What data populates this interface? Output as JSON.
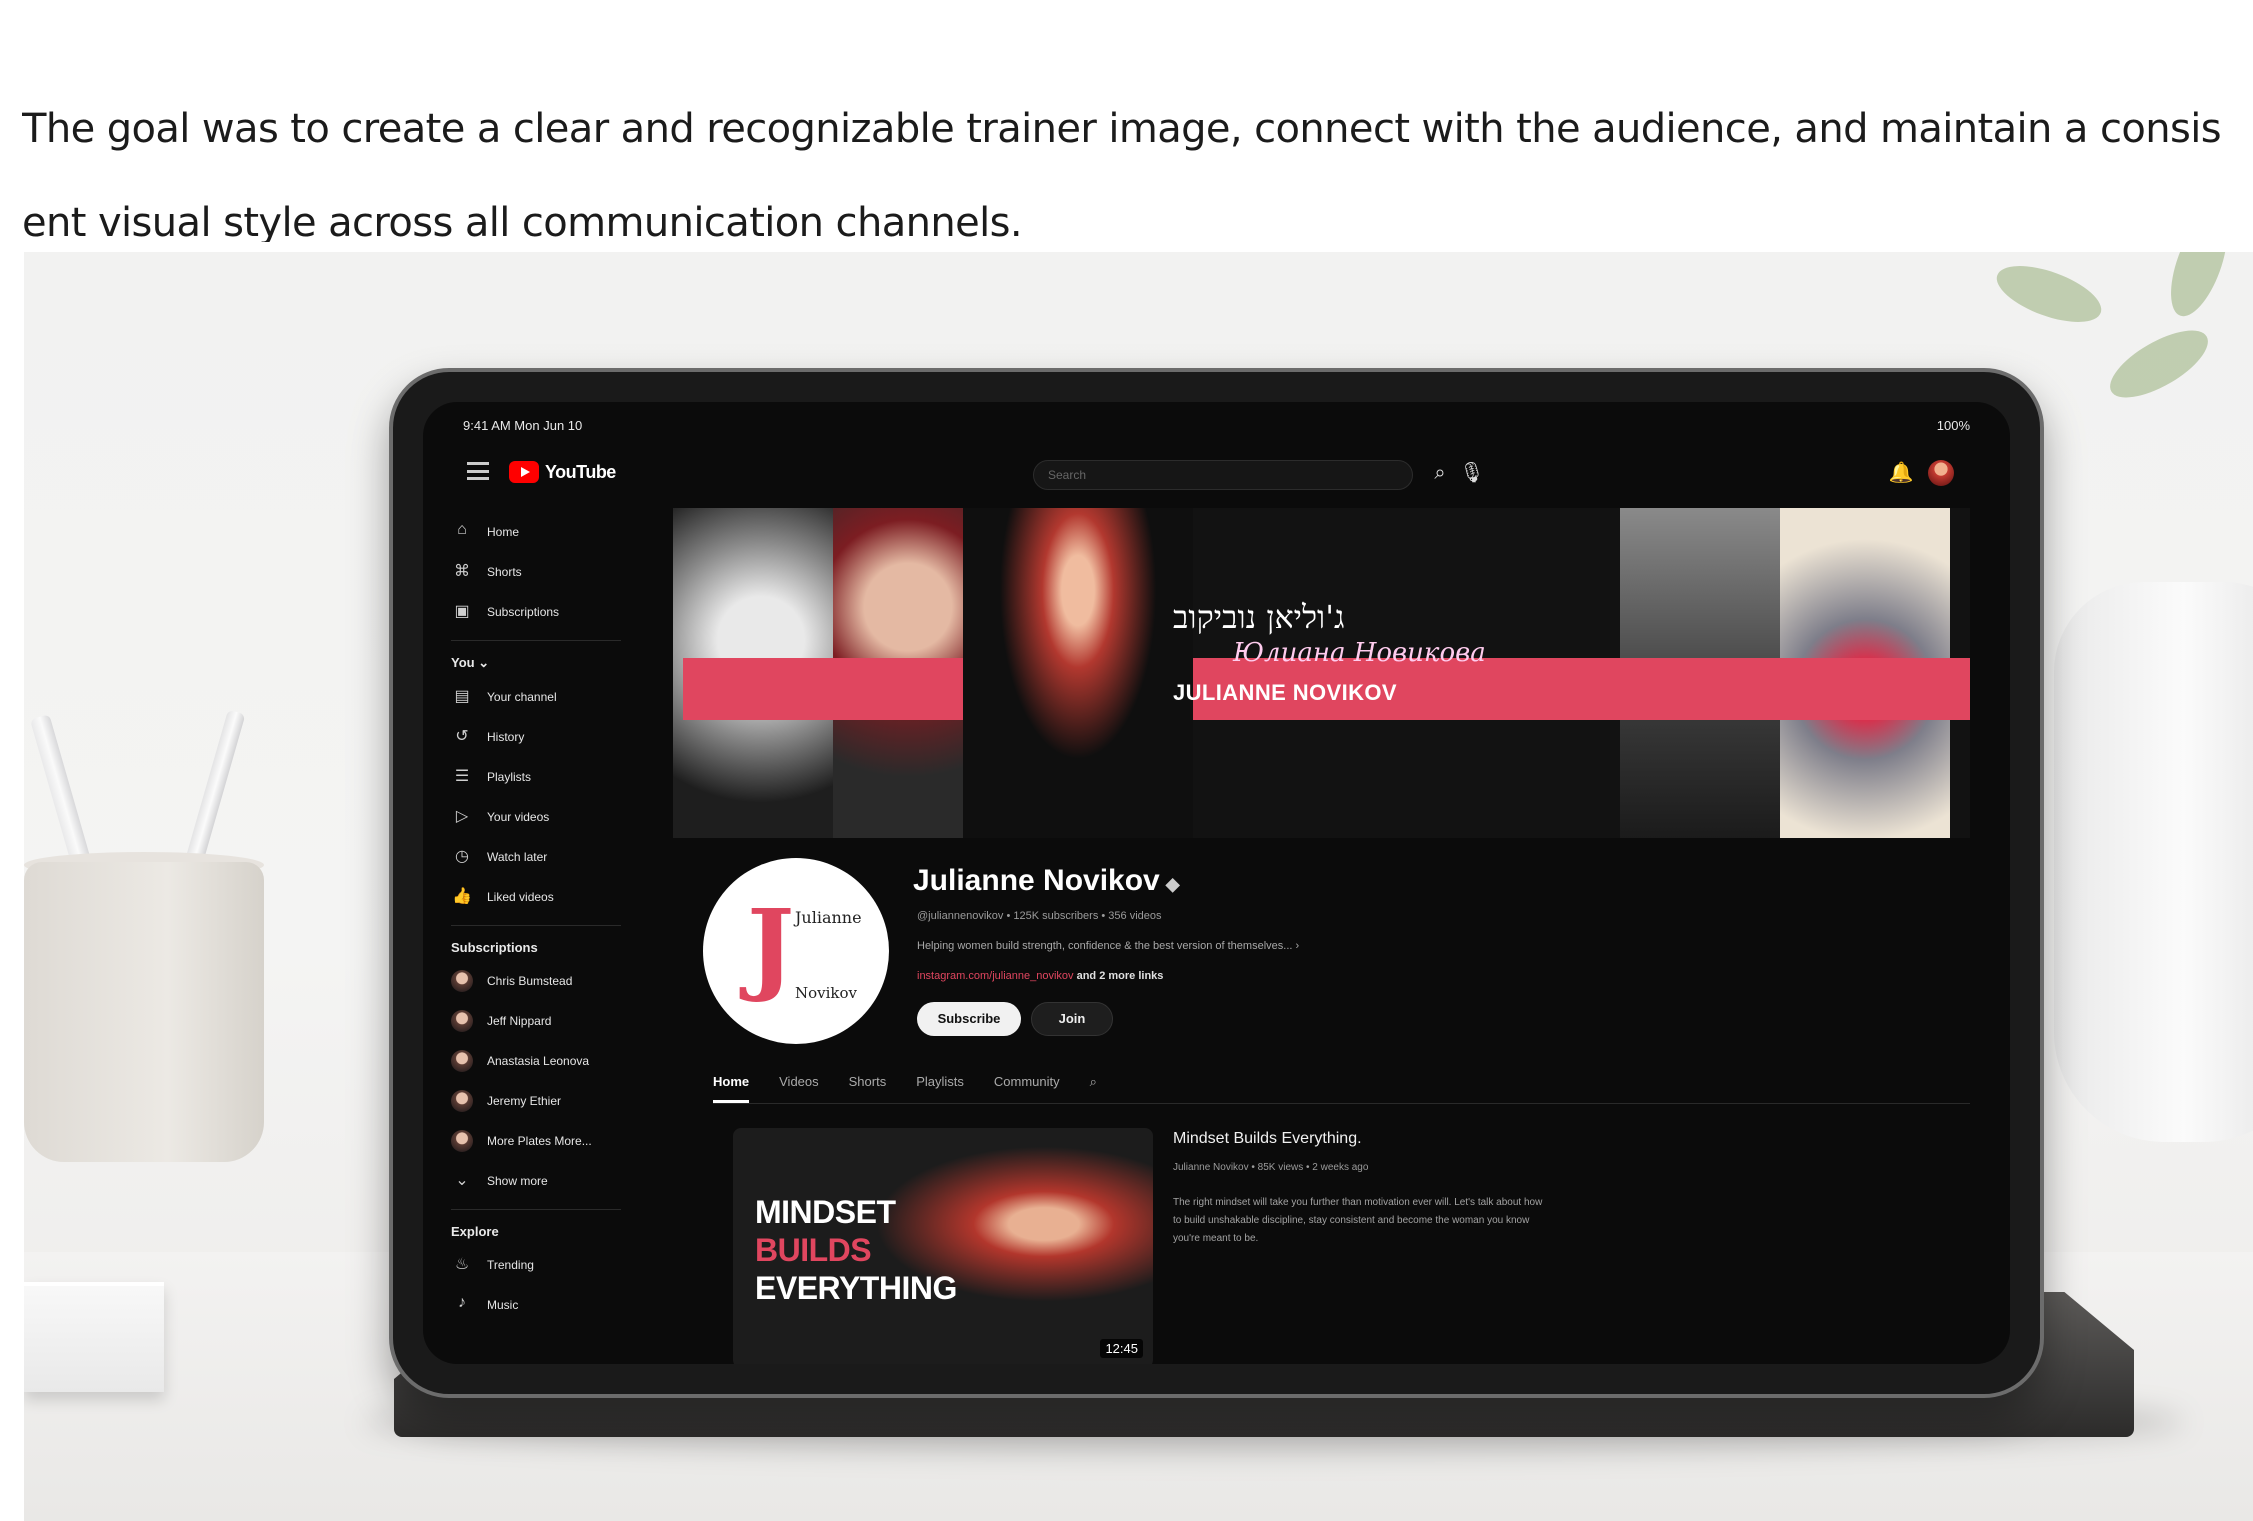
{
  "intro": {
    "line1": "The goal was to create a clear and recognizable trainer image, connect with the audience, and maintain a consis",
    "line2": "ent visual style across all communication channels."
  },
  "status_bar": {
    "time": "9:41 AM  Mon Jun 10",
    "battery": "100%"
  },
  "topbar": {
    "app_name": "YouTube",
    "search_placeholder": "Search",
    "icons": [
      "menu-icon",
      "search-icon",
      "mic-icon",
      "bell-icon",
      "avatar"
    ]
  },
  "sidebar": {
    "main": [
      {
        "label": "Home",
        "icon": "home-icon"
      },
      {
        "label": "Shorts",
        "icon": "shorts-icon"
      },
      {
        "label": "Subscriptions",
        "icon": "subscriptions-icon"
      }
    ],
    "you_label": "You",
    "you": [
      {
        "label": "Your channel",
        "icon": "channel-icon"
      },
      {
        "label": "History",
        "icon": "history-icon"
      },
      {
        "label": "Playlists",
        "icon": "playlist-icon"
      },
      {
        "label": "Your videos",
        "icon": "video-icon"
      },
      {
        "label": "Watch later",
        "icon": "clock-icon"
      },
      {
        "label": "Liked videos",
        "icon": "like-icon"
      }
    ],
    "subscriptions_label": "Subscriptions",
    "subscriptions": [
      "Chris Bumstead",
      "Jeff Nippard",
      "Anastasia Leonova",
      "Jeremy Ethier",
      "More Plates More..."
    ],
    "show_more": "Show more",
    "explore_label": "Explore",
    "explore": [
      {
        "label": "Trending",
        "icon": "trending-icon"
      },
      {
        "label": "Music",
        "icon": "music-icon"
      }
    ]
  },
  "banner": {
    "hebrew_name": "ג'וליאן נוביקוב",
    "cyrillic_signature": "Юлиана Новикова",
    "name": "JULIANNE NOVIKOV",
    "accent": "#e0465f"
  },
  "channel": {
    "logo_line1": "Julianne",
    "logo_line2": "Novikov",
    "name": "Julianne Novikov",
    "meta": "@juliannenovikov • 125K subscribers • 356 videos",
    "description": "Helping women build strength, confidence & the best version of themselves...",
    "link": "instagram.com/julianne_novikov",
    "more_links": "and 2 more links",
    "subscribe": "Subscribe",
    "join": "Join"
  },
  "tabs": [
    "Home",
    "Videos",
    "Shorts",
    "Playlists",
    "Community"
  ],
  "featured_video": {
    "thumb_line1": "MINDSET",
    "thumb_line2": "BUILDS",
    "thumb_line3": "EVERYTHING",
    "duration": "12:45",
    "title": "Mindset Builds Everything.",
    "meta": "Julianne Novikov • 85K views • 2 weeks ago",
    "description": "The right mindset will take you further than motivation ever will. Let's talk about how to build unshakable discipline, stay consistent and become the woman you know you're meant to be."
  }
}
